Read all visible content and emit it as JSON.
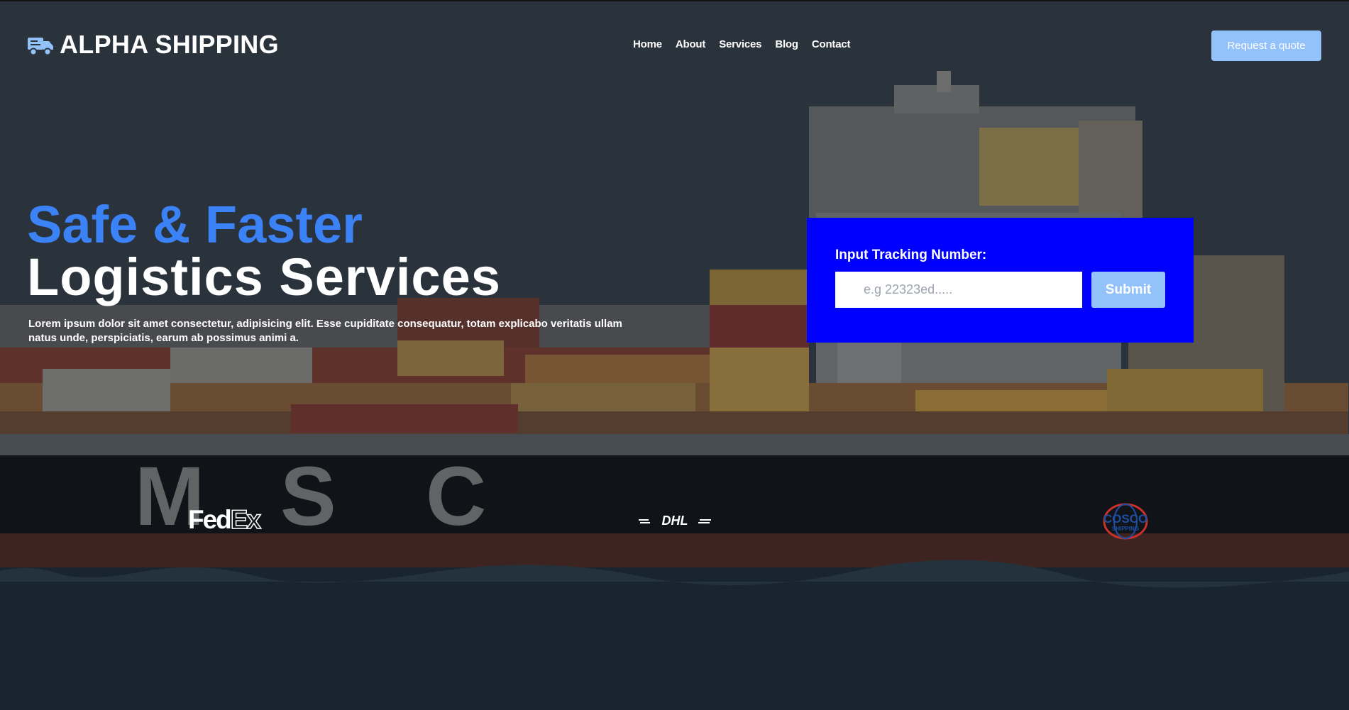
{
  "header": {
    "brand": "ALPHA SHIPPING",
    "brand_icon": "truck-icon",
    "nav": [
      "Home",
      "About",
      "Services",
      "Blog",
      "Contact"
    ],
    "cta_label": "Request a quote"
  },
  "hero": {
    "headline_accent": "Safe & Faster",
    "headline_main": "Logistics Services",
    "description": "Lorem ipsum dolor sit amet consectetur, adipisicing elit. Esse cupiditate consequatur, totam explicabo veritatis ullam natus unde, perspiciatis, earum ab possimus animi a."
  },
  "tracking": {
    "label": "Input Tracking Number:",
    "placeholder": "e.g 22323ed.....",
    "submit_label": "Submit"
  },
  "partners": {
    "fedex_fed": "Fed",
    "fedex_ex": "Ex",
    "dhl": "DHL",
    "cosco_top": "COSCO",
    "cosco_bottom": "SHIPPING"
  },
  "background": {
    "hull_letters": [
      "M",
      "S",
      "C"
    ]
  },
  "colors": {
    "accent_blue": "#3b82f6",
    "panel_blue": "#0000ff",
    "button_light_blue": "#93c2fb",
    "background": "#2d353e"
  }
}
